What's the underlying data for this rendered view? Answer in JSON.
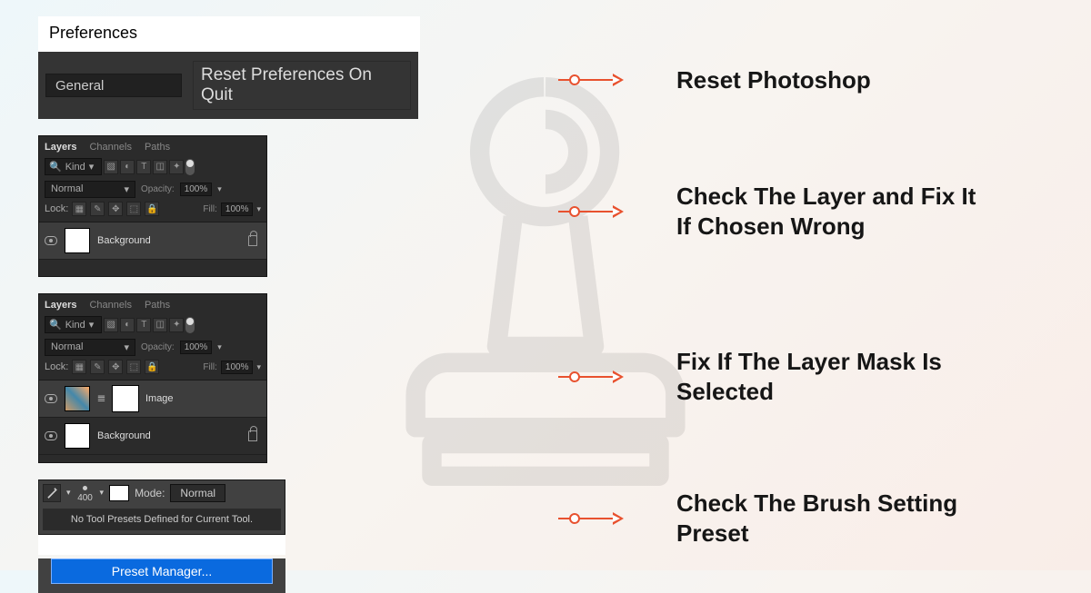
{
  "preferences": {
    "title": "Preferences",
    "dropdown": "General",
    "button": "Reset Preferences On Quit"
  },
  "layers_panel": {
    "tabs": {
      "layers": "Layers",
      "channels": "Channels",
      "paths": "Paths"
    },
    "filter_label": "Kind",
    "blend_mode": "Normal",
    "opacity_label": "Opacity:",
    "opacity_value": "100%",
    "lock_label": "Lock:",
    "fill_label": "Fill:",
    "fill_value": "100%",
    "layer_background": "Background",
    "layer_image": "Image"
  },
  "brush_bar": {
    "size": "400",
    "mode_label": "Mode:",
    "mode_value": "Normal",
    "no_preset_msg": "No Tool Presets Defined for Current Tool.",
    "preset_manager": "Preset Manager..."
  },
  "callouts": {
    "c1": "Reset Photoshop",
    "c2": "Check The Layer and Fix It If Chosen Wrong",
    "c3": "Fix If The Layer Mask Is Selected",
    "c4": "Check The Brush Setting Preset"
  }
}
